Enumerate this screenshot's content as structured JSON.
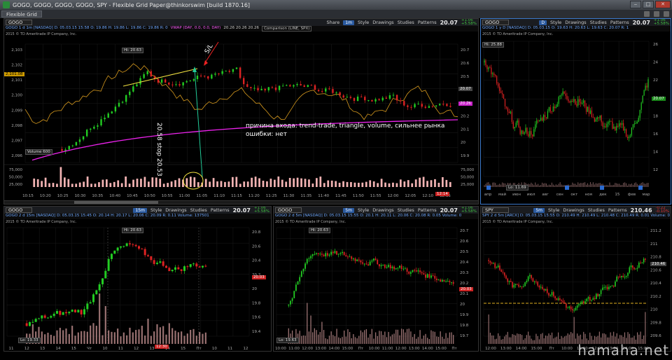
{
  "window": {
    "title": "GOGO, GOGO, GOGO, GOGO, SPY - Flexible Grid Paper@thinkorswim [build 1870.16]",
    "tab": "Flexible Grid"
  },
  "toolbar_labels": {
    "share": "Share",
    "style": "Style",
    "drawings": "Drawings",
    "studies": "Studies",
    "patterns": "Patterns"
  },
  "panel_main": {
    "symbol": "GOGO",
    "interval": "1m",
    "price": "20.07",
    "change": "+1.06",
    "change_pct": "+5.58%",
    "info": "GOGO 1 d 1m [NASDAQ]  D: 05.03.15 15:58  O: 19.86  H: 19.86  L: 19.86  C: 19.86  R: 0",
    "vwap": "VWAP (DAY, 0.0, 0.0, DAY)",
    "vwap_vals": "20.26  20.26  20.26",
    "comparison": "Comparison (LINE, SPX)",
    "copyright": "2015 © TD Ameritrade IP Company, Inc.",
    "hi_label": "Hi: 20.63",
    "left_tag": "2,101.08",
    "vwap_tag": "20.26",
    "price_tag": "20.07",
    "volume_label": "Volume",
    "volume_val": "600",
    "time_tag": "12:14",
    "y_ticks_left": [
      "2,103",
      "2,102",
      "2,101",
      "2,100",
      "2,099",
      "2,098",
      "2,097",
      "2,096"
    ],
    "y_ticks_right": [
      "20.7",
      "20.6",
      "20.5",
      "20.4",
      "20.3",
      "20.2",
      "20.1",
      "20",
      "19.9"
    ],
    "vol_ticks": [
      "75,000",
      "50,000",
      "25,000"
    ],
    "x_ticks": [
      "10:15",
      "10:20",
      "10:25",
      "10:30",
      "10:35",
      "10:40",
      "10:45",
      "10:50",
      "10:55",
      "11:00",
      "11:05",
      "11:10",
      "11:15",
      "11:20",
      "11:25",
      "11:30",
      "11:35",
      "11:40",
      "11:45",
      "11:50",
      "11:55",
      "12:00",
      "12:05",
      "12:10",
      "12:15"
    ],
    "annotation_sl": "S/L",
    "annotation_stop": "20.58 stop 20.53",
    "annotation_reason": "причина входа: trend-trade, triangle, volume, сильнее рынка",
    "annotation_errors": "ошибки: нет"
  },
  "panel_tr": {
    "symbol": "GOGO",
    "interval": "D",
    "price": "20.07",
    "change": "+1.06",
    "change_pct": "+5.58%",
    "info": "GOGO 1 y D [NASDAQ]  D: 05.03.15  O: 19.63  H: 20.63  L: 19.63  C: 20.07  R: 1",
    "copyright": "2015 © TD Ameritrade IP Company, Inc.",
    "hi_label": "Hi: 25.88",
    "lo_label": "Lo: 11.69",
    "price_tag": "20.07",
    "y_ticks": [
      "26",
      "24",
      "22",
      "20",
      "18",
      "16",
      "14",
      "12"
    ],
    "x_ticks": [
      "апр",
      "май",
      "июн",
      "июл",
      "авг",
      "сен",
      "окт",
      "ноя",
      "дек",
      "15",
      "фев",
      "мар"
    ]
  },
  "panel_bl": {
    "symbol": "GOGO",
    "interval": "15m",
    "price": "20.07",
    "change": "+1.06",
    "change_pct": "+5.58%",
    "info": "GOGO 2 d 15m [NASDAQ]  D: 05.03.15 15:45  O: 20.14  H: 20.17  L: 20.06  C: 20.09  R: 0.11  Volume: 137501",
    "copyright": "2015 © TD Ameritrade IP Company, Inc.",
    "hi_label": "Hi: 20.63",
    "lo_label": "Lo: 19.33",
    "price_tag": "20.03",
    "time_tag": "12:30",
    "y_ticks": [
      "20.8",
      "20.6",
      "20.4",
      "20.2",
      "20",
      "19.8",
      "19.6",
      "19.4"
    ],
    "x_ticks": [
      "11",
      "12",
      "13",
      "14",
      "15",
      "Чт",
      "10",
      "11",
      "12",
      "13",
      "14",
      "15",
      "Пт",
      "10",
      "11",
      "12"
    ]
  },
  "panel_bm": {
    "symbol": "GOGO",
    "interval": "5m",
    "price": "20.07",
    "change": "+1.06",
    "change_pct": "+5.58%",
    "info": "GOGO 2 d 5m [NASDAQ]  D: 05.03.15 15:55  O: 20.1  H: 20.11  L: 20.06  C: 20.08  R: 0.05  Volume: 0",
    "copyright": "2015 © TD Ameritrade IP Company, Inc.",
    "hi_label": "Hi: 20.63",
    "lo_label": "Lo: 19.63",
    "price_tag": "20.03",
    "y_ticks": [
      "20.7",
      "20.6",
      "20.5",
      "20.4",
      "20.3",
      "20.2",
      "20.1",
      "20",
      "19.9",
      "19.8",
      "19.7"
    ],
    "x_ticks": [
      "10:00",
      "11:00",
      "12:00",
      "13:00",
      "14:00",
      "15:00",
      "Пт",
      "10:00",
      "11:00",
      "12:00",
      "13:00",
      "14:00",
      "15:00",
      "Пт"
    ]
  },
  "panel_br": {
    "symbol": "SPY",
    "interval": "5m",
    "price": "210.46",
    "change": "-0.22",
    "change_pct": "-0.10%",
    "info": "SPY 2 d 5m [ARCX]  D: 05.03.15 15:55  O: 210.49  H: 210.49  L: 210.48  C: 210.49  R: 0.01  Volume: 0",
    "copyright": "2015 © TD Ameritrade IP Company, Inc.",
    "price_tag": "210.46",
    "y_ticks": [
      "211.2",
      "211",
      "210.8",
      "210.6",
      "210.4",
      "210.2",
      "210",
      "209.8",
      "209.6"
    ],
    "x_ticks": [
      "12:00",
      "13:00",
      "14:00",
      "15:00",
      "Пт",
      "10:00",
      "11:00",
      "12:00",
      "13:00",
      "14:00",
      "15:00"
    ]
  },
  "site_watermark": "hamaha.net",
  "colors": {
    "up": "#22cc22",
    "down": "#dd2222",
    "vwap": "#ee22ee",
    "compare": "#d79a1e",
    "trend": "#f0e040",
    "arrow": "#22cc99",
    "accent": "#3a78c8"
  }
}
